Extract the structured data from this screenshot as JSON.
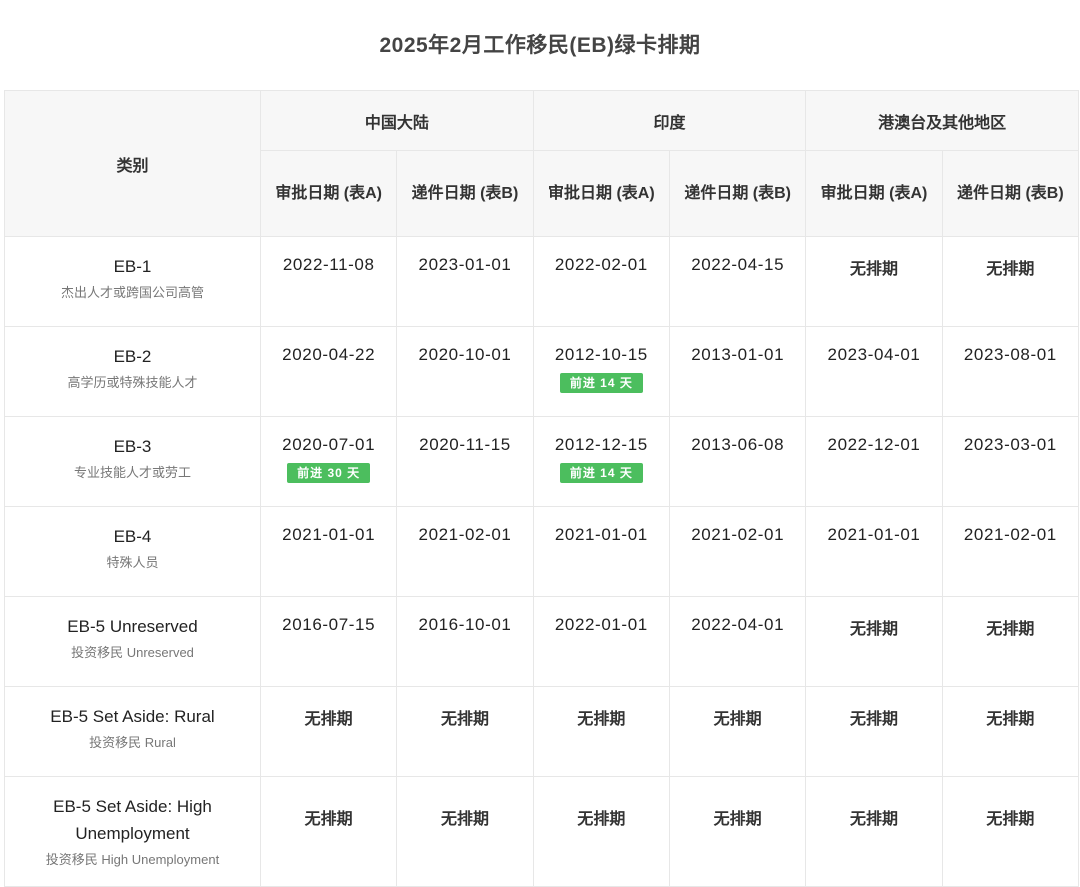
{
  "title": "2025年2月工作移民(EB)绿卡排期",
  "header": {
    "category": "类别",
    "regions": [
      "中国大陆",
      "印度",
      "港澳台及其他地区"
    ],
    "col_a": "审批日期 (表A)",
    "col_b": "递件日期 (表B)"
  },
  "rows": [
    {
      "name": "EB-1",
      "sub": "杰出人才或跨国公司高管",
      "cells": [
        {
          "value": "2022-11-08",
          "badge": ""
        },
        {
          "value": "2023-01-01",
          "badge": ""
        },
        {
          "value": "2022-02-01",
          "badge": ""
        },
        {
          "value": "2022-04-15",
          "badge": ""
        },
        {
          "value": "无排期",
          "badge": ""
        },
        {
          "value": "无排期",
          "badge": ""
        }
      ]
    },
    {
      "name": "EB-2",
      "sub": "高学历或特殊技能人才",
      "cells": [
        {
          "value": "2020-04-22",
          "badge": ""
        },
        {
          "value": "2020-10-01",
          "badge": ""
        },
        {
          "value": "2012-10-15",
          "badge": "前进 14 天"
        },
        {
          "value": "2013-01-01",
          "badge": ""
        },
        {
          "value": "2023-04-01",
          "badge": ""
        },
        {
          "value": "2023-08-01",
          "badge": ""
        }
      ]
    },
    {
      "name": "EB-3",
      "sub": "专业技能人才或劳工",
      "cells": [
        {
          "value": "2020-07-01",
          "badge": "前进 30 天"
        },
        {
          "value": "2020-11-15",
          "badge": ""
        },
        {
          "value": "2012-12-15",
          "badge": "前进 14 天"
        },
        {
          "value": "2013-06-08",
          "badge": ""
        },
        {
          "value": "2022-12-01",
          "badge": ""
        },
        {
          "value": "2023-03-01",
          "badge": ""
        }
      ]
    },
    {
      "name": "EB-4",
      "sub": "特殊人员",
      "cells": [
        {
          "value": "2021-01-01",
          "badge": ""
        },
        {
          "value": "2021-02-01",
          "badge": ""
        },
        {
          "value": "2021-01-01",
          "badge": ""
        },
        {
          "value": "2021-02-01",
          "badge": ""
        },
        {
          "value": "2021-01-01",
          "badge": ""
        },
        {
          "value": "2021-02-01",
          "badge": ""
        }
      ]
    },
    {
      "name": "EB-5 Unreserved",
      "sub": "投资移民 Unreserved",
      "cells": [
        {
          "value": "2016-07-15",
          "badge": ""
        },
        {
          "value": "2016-10-01",
          "badge": ""
        },
        {
          "value": "2022-01-01",
          "badge": ""
        },
        {
          "value": "2022-04-01",
          "badge": ""
        },
        {
          "value": "无排期",
          "badge": ""
        },
        {
          "value": "无排期",
          "badge": ""
        }
      ]
    },
    {
      "name": "EB-5 Set Aside: Rural",
      "sub": "投资移民 Rural",
      "cells": [
        {
          "value": "无排期",
          "badge": ""
        },
        {
          "value": "无排期",
          "badge": ""
        },
        {
          "value": "无排期",
          "badge": ""
        },
        {
          "value": "无排期",
          "badge": ""
        },
        {
          "value": "无排期",
          "badge": ""
        },
        {
          "value": "无排期",
          "badge": ""
        }
      ]
    },
    {
      "name": "EB-5 Set Aside: High Unemployment",
      "sub": "投资移民 High Unemployment",
      "cells": [
        {
          "value": "无排期",
          "badge": ""
        },
        {
          "value": "无排期",
          "badge": ""
        },
        {
          "value": "无排期",
          "badge": ""
        },
        {
          "value": "无排期",
          "badge": ""
        },
        {
          "value": "无排期",
          "badge": ""
        },
        {
          "value": "无排期",
          "badge": ""
        }
      ]
    }
  ]
}
